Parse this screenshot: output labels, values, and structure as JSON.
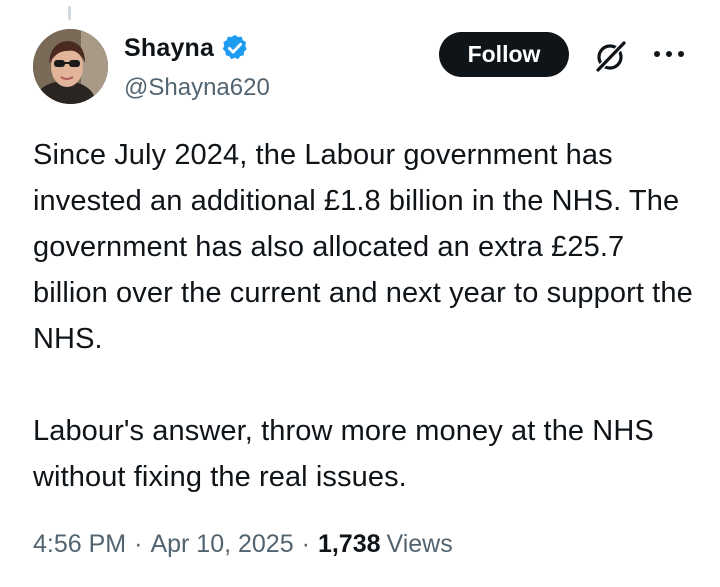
{
  "author": {
    "display_name": "Shayna",
    "handle": "@Shayna620",
    "verified_icon": "verified-badge-icon",
    "avatar_icon": "avatar"
  },
  "actions": {
    "follow_label": "Follow",
    "grok_icon": "grok-icon",
    "more_icon": "more-options-icon"
  },
  "tweet": {
    "paragraph_1": "Since July 2024, the Labour government has invested an additional £1.8 billion in the NHS.  The government has also allocated an extra £25.7 billion over the current and next year to support the NHS.",
    "paragraph_2": "Labour's answer, throw more money at the NHS without fixing the real issues."
  },
  "meta": {
    "time": "4:56 PM",
    "date": "Apr 10, 2025",
    "separator": "·",
    "views_count": "1,738",
    "views_label": "Views"
  },
  "colors": {
    "text_primary": "#0f1419",
    "text_secondary": "#536471",
    "verified_blue": "#1d9bf0",
    "button_bg": "#0f1419"
  }
}
